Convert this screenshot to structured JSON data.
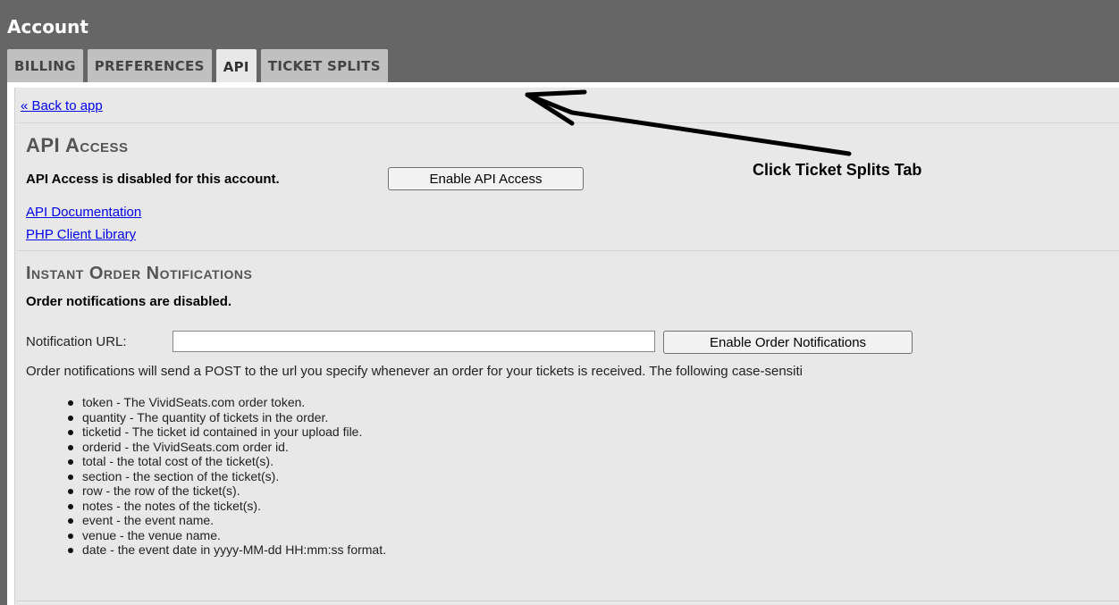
{
  "header": {
    "title": "Account"
  },
  "tabs": [
    {
      "label": "BILLING"
    },
    {
      "label": "PREFERENCES"
    },
    {
      "label": "API"
    },
    {
      "label": "TICKET SPLITS"
    }
  ],
  "back_link": "« Back to app",
  "api_section": {
    "title": "API Access",
    "status": "API Access is disabled for this account.",
    "enable_button": "Enable API Access",
    "links": [
      "API Documentation",
      "PHP Client Library"
    ]
  },
  "notifications": {
    "title": "Instant Order Notifications",
    "status": "Order notifications are disabled.",
    "url_label": "Notification URL:",
    "url_value": "",
    "enable_button": "Enable Order Notifications",
    "description": "Order notifications will send a POST to the url you specify whenever an order for your tickets is received. The following case-sensiti",
    "fields": [
      "token - The VividSeats.com order token.",
      "quantity - The quantity of tickets in the order.",
      "ticketid - The ticket id contained in your upload file.",
      "orderid - the VividSeats.com order id.",
      "total - the total cost of the ticket(s).",
      "section - the section of the ticket(s).",
      "row - the row of the ticket(s).",
      "notes - the notes of the ticket(s).",
      "event - the event name.",
      "venue - the venue name.",
      "date - the event date in yyyy-MM-dd HH:mm:ss format."
    ]
  },
  "annotation": {
    "text": "Click Ticket Splits Tab",
    "icon": "arrow-icon"
  }
}
